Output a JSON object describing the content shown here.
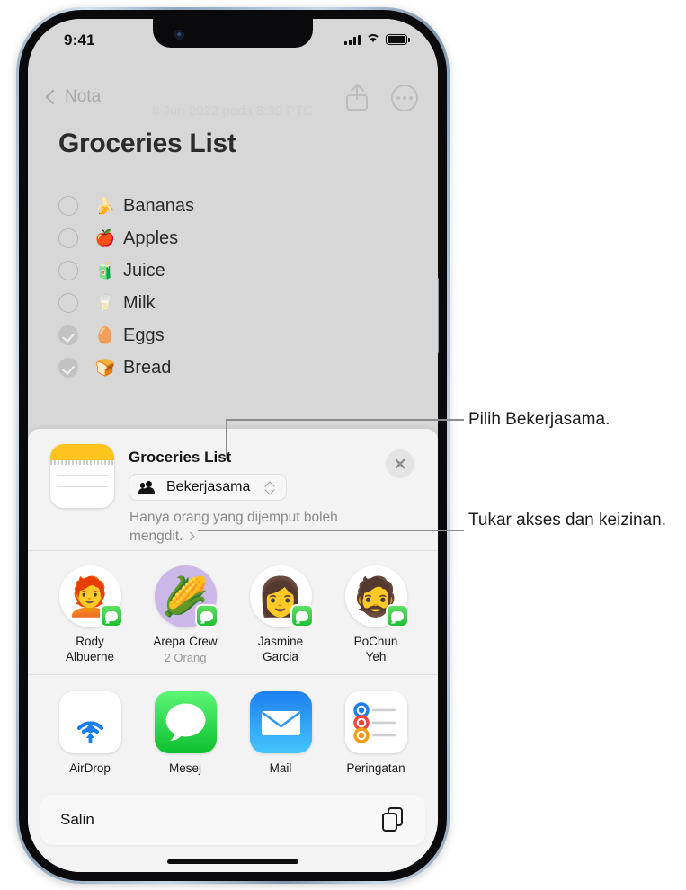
{
  "status_bar": {
    "time": "9:41",
    "icons": [
      "cellular-signal-icon",
      "wifi-icon",
      "battery-icon"
    ]
  },
  "nav_bar": {
    "back_label": "Nota",
    "date_text": "8 Jun 2022 pada 8:39 PTG",
    "share_icon": "share-icon",
    "more_icon": "more-icon"
  },
  "note": {
    "title": "Groceries List",
    "items": [
      {
        "emoji": "🍌",
        "label": "Bananas",
        "checked": false
      },
      {
        "emoji": "🍎",
        "label": "Apples",
        "checked": false
      },
      {
        "emoji": "🧃",
        "label": "Juice",
        "checked": false
      },
      {
        "emoji": "🥛",
        "label": "Milk",
        "checked": false
      },
      {
        "emoji": "🥚",
        "label": "Eggs",
        "checked": true
      },
      {
        "emoji": "🍞",
        "label": "Bread",
        "checked": true
      }
    ]
  },
  "share_sheet": {
    "doc_title": "Groceries List",
    "app_icon": "notes-app-icon",
    "collaborate": {
      "label": "Bekerjasama",
      "icon": "people-icon",
      "selector_icon": "up-down-chevron-icon"
    },
    "permission_text": "Hanya orang yang dijemput boleh mengdit.",
    "permission_chevron": "chevron-right-icon",
    "close_icon": "close-icon",
    "contacts": [
      {
        "name_line1": "Rody",
        "name_line2": "Albuerne",
        "sub": "",
        "avatar": "🧑‍🦰",
        "badge": "messages-badge"
      },
      {
        "name_line1": "Arepa Crew",
        "name_line2": "",
        "sub": "2 Orang",
        "avatar": "🌽",
        "badge": "messages-badge"
      },
      {
        "name_line1": "Jasmine",
        "name_line2": "Garcia",
        "sub": "",
        "avatar": "👩",
        "badge": "messages-badge"
      },
      {
        "name_line1": "PoChun",
        "name_line2": "Yeh",
        "sub": "",
        "avatar": "🧔",
        "badge": "messages-badge"
      }
    ],
    "apps": [
      {
        "label": "AirDrop",
        "icon": "airdrop-icon"
      },
      {
        "label": "Mesej",
        "icon": "messages-icon"
      },
      {
        "label": "Mail",
        "icon": "mail-icon"
      },
      {
        "label": "Peringatan",
        "icon": "reminders-icon"
      }
    ],
    "copy_action": {
      "label": "Salin",
      "icon": "copy-icon"
    }
  },
  "callouts": [
    {
      "text": "Pilih Bekerjasama."
    },
    {
      "text": "Tukar akses dan keizinan."
    }
  ],
  "colors": {
    "notes_yellow": "#fcc41d",
    "messages_green": "#1fbe35",
    "mail_blue": "#1d7ff0",
    "screen_bg": "#d7d7d7",
    "sheet_bg": "#f3f3f3"
  }
}
